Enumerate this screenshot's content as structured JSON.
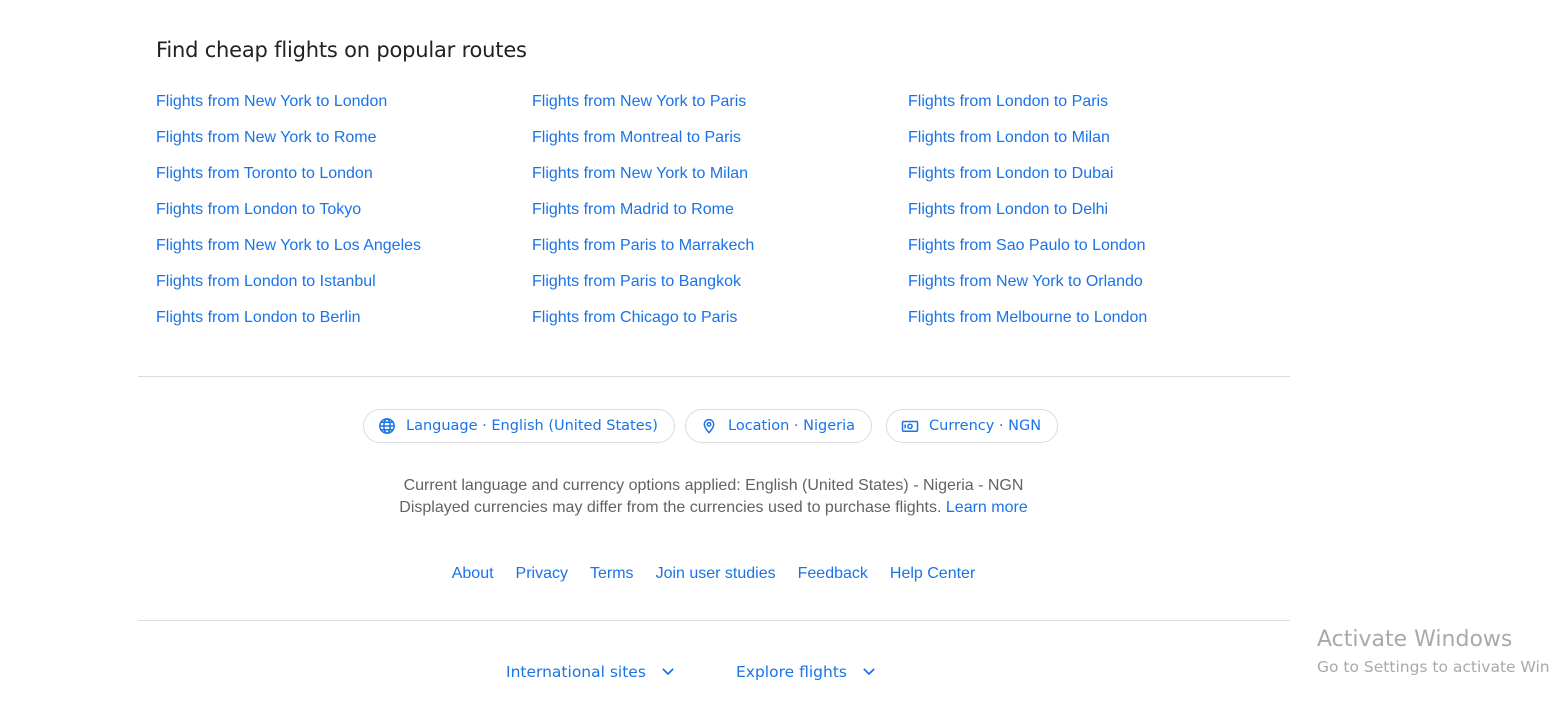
{
  "section": {
    "title": "Find cheap flights on popular routes"
  },
  "routes": {
    "col1": [
      "Flights from New York to London",
      "Flights from New York to Rome",
      "Flights from Toronto to London",
      "Flights from London to Tokyo",
      "Flights from New York to Los Angeles",
      "Flights from London to Istanbul",
      "Flights from London to Berlin"
    ],
    "col2": [
      "Flights from New York to Paris",
      "Flights from Montreal to Paris",
      "Flights from New York to Milan",
      "Flights from Madrid to Rome",
      "Flights from Paris to Marrakech",
      "Flights from Paris to Bangkok",
      "Flights from Chicago to Paris"
    ],
    "col3": [
      "Flights from London to Paris",
      "Flights from London to Milan",
      "Flights from London to Dubai",
      "Flights from London to Delhi",
      "Flights from Sao Paulo to London",
      "Flights from New York to Orlando",
      "Flights from Melbourne to London"
    ]
  },
  "settings": {
    "language": {
      "label": "Language · English (United States)",
      "icon": "globe-icon"
    },
    "location": {
      "label": "Location · Nigeria",
      "icon": "location-pin-icon"
    },
    "currency": {
      "label": "Currency · NGN",
      "icon": "currency-icon"
    }
  },
  "notice": {
    "line1": "Current language and currency options applied: English (United States) - Nigeria - NGN",
    "line2": "Displayed currencies may differ from the currencies used to purchase flights.",
    "learn_more": "Learn more"
  },
  "footer_links": [
    "About",
    "Privacy",
    "Terms",
    "Join user studies",
    "Feedback",
    "Help Center"
  ],
  "expanders": {
    "international": "International sites",
    "explore": "Explore flights"
  },
  "watermark": {
    "title": "Activate Windows",
    "subtitle": "Go to Settings to activate Win"
  },
  "colors": {
    "link": "#1a73e8",
    "text": "#202124",
    "muted": "#5f6368",
    "divider": "#dadce0"
  }
}
